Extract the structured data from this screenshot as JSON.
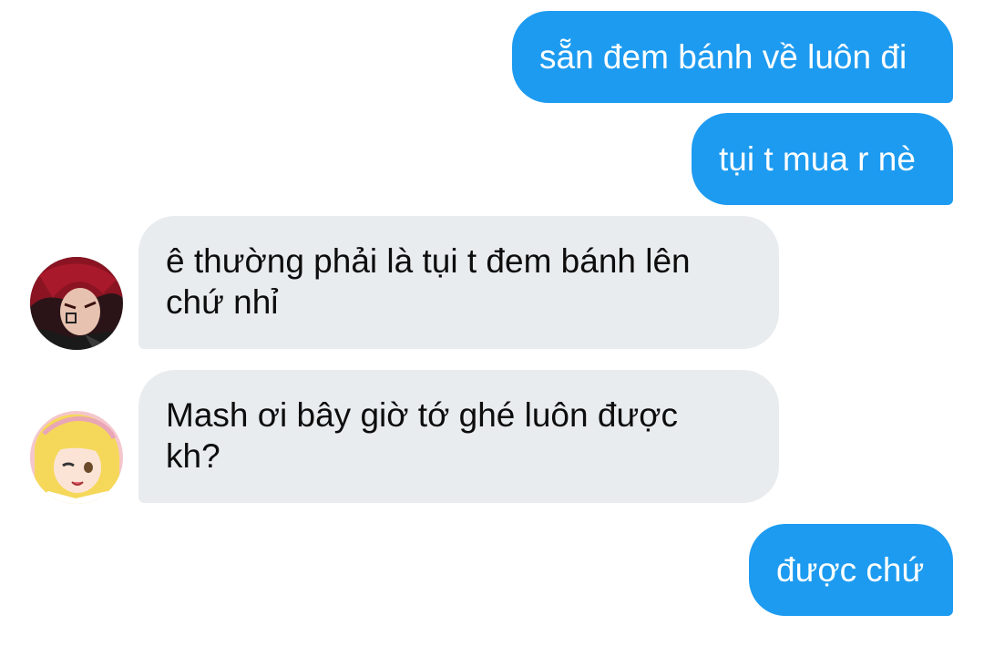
{
  "messages": [
    {
      "direction": "sent",
      "text": "sẵn đem bánh về luôn đi"
    },
    {
      "direction": "sent",
      "text": "tụi t mua r nè"
    },
    {
      "direction": "received",
      "avatar": "red-haired-character-avatar",
      "lines": [
        "ê thường phải là tụi t đem bánh lên",
        "chứ nhỉ"
      ]
    },
    {
      "direction": "received",
      "avatar": "blonde-character-avatar",
      "lines": [
        "Mash ơi bây giờ tớ ghé luôn được",
        "kh?"
      ]
    },
    {
      "direction": "sent",
      "text": "được chứ"
    }
  ],
  "colors": {
    "sent_bubble": "#1d9bf0",
    "received_bubble": "#e9ecef",
    "background": "#ffffff"
  }
}
